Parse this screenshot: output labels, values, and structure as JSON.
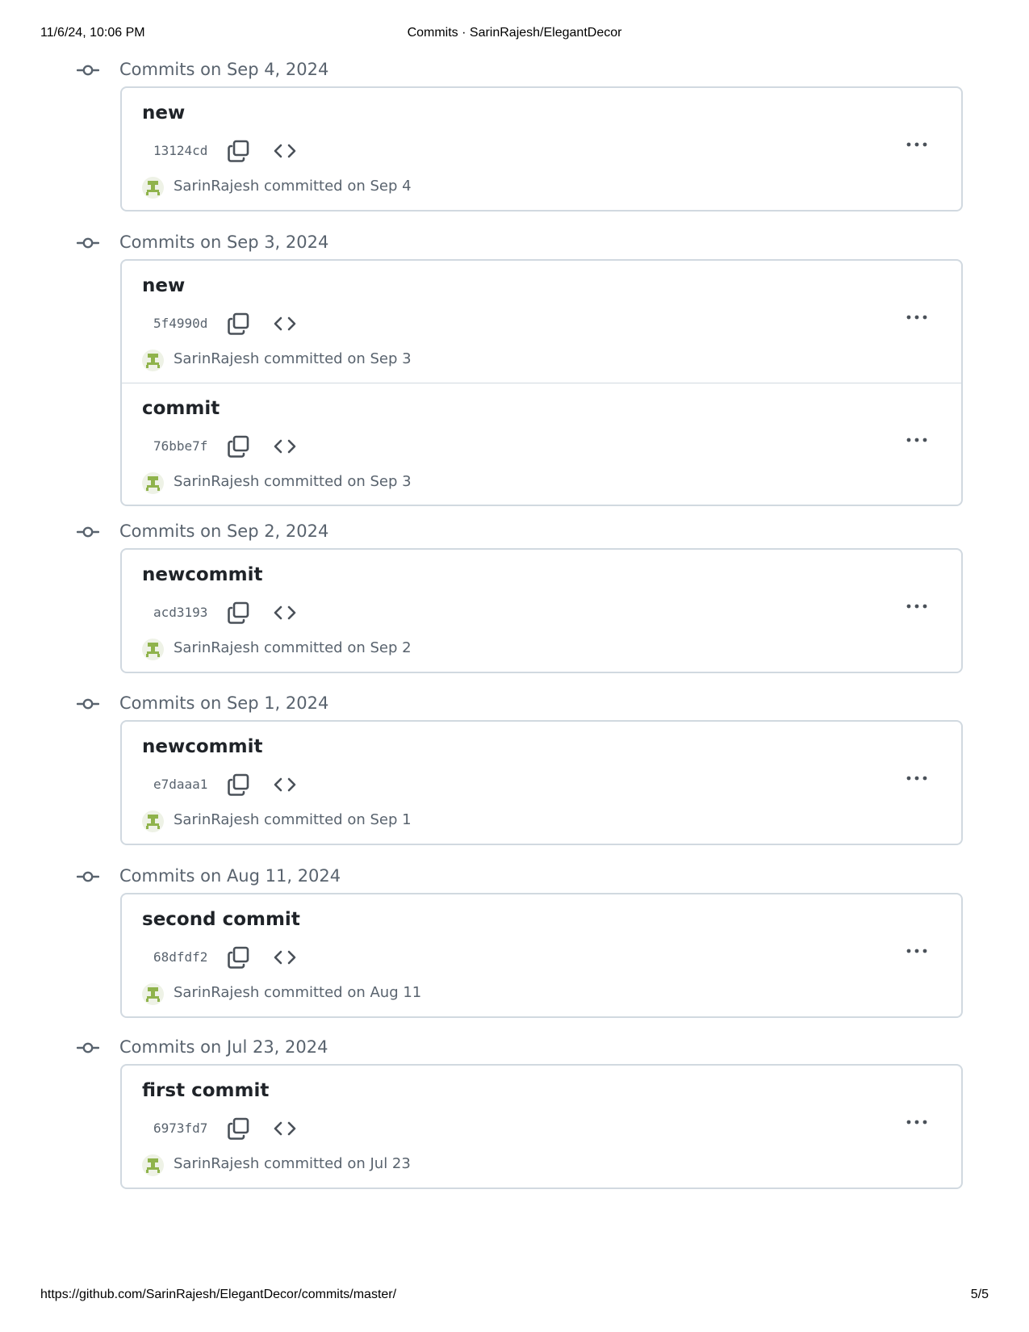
{
  "print_header": {
    "datetime": "11/6/24, 10:06 PM",
    "page_title": "Commits · SarinRajesh/ElegantDecor"
  },
  "print_footer": {
    "url": "https://github.com/SarinRajesh/ElegantDecor/commits/master/",
    "page_number": "5/5"
  },
  "colors": {
    "text_primary": "#1f2328",
    "text_muted": "#59636e",
    "border": "#d1d9e0",
    "avatar_green": "#8fb34b"
  },
  "icons": {
    "timeline_node": "git-commit-icon",
    "copy": "copy-icon",
    "browse": "code-icon",
    "more": "kebab-horizontal-icon"
  },
  "groups": [
    {
      "title": "Commits on Sep 4, 2024",
      "commits": [
        {
          "message": "new",
          "sha": "13124cd",
          "author": "SarinRajesh",
          "action": "committed",
          "date": "on Sep 4"
        }
      ]
    },
    {
      "title": "Commits on Sep 3, 2024",
      "commits": [
        {
          "message": "new",
          "sha": "5f4990d",
          "author": "SarinRajesh",
          "action": "committed",
          "date": "on Sep 3"
        },
        {
          "message": "commit",
          "sha": "76bbe7f",
          "author": "SarinRajesh",
          "action": "committed",
          "date": "on Sep 3"
        }
      ]
    },
    {
      "title": "Commits on Sep 2, 2024",
      "commits": [
        {
          "message": "newcommit",
          "sha": "acd3193",
          "author": "SarinRajesh",
          "action": "committed",
          "date": "on Sep 2"
        }
      ]
    },
    {
      "title": "Commits on Sep 1, 2024",
      "commits": [
        {
          "message": "newcommit",
          "sha": "e7daaa1",
          "author": "SarinRajesh",
          "action": "committed",
          "date": "on Sep 1"
        }
      ]
    },
    {
      "title": "Commits on Aug 11, 2024",
      "commits": [
        {
          "message": "second commit",
          "sha": "68dfdf2",
          "author": "SarinRajesh",
          "action": "committed",
          "date": "on Aug 11"
        }
      ]
    },
    {
      "title": "Commits on Jul 23, 2024",
      "commits": [
        {
          "message": "first commit",
          "sha": "6973fd7",
          "author": "SarinRajesh",
          "action": "committed",
          "date": "on Jul 23"
        }
      ]
    }
  ]
}
